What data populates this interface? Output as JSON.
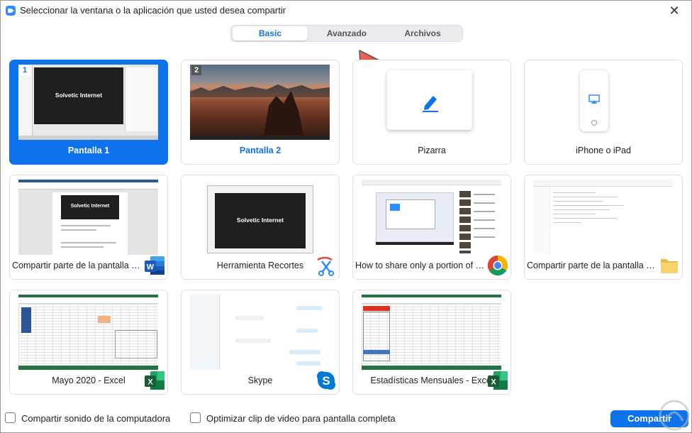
{
  "window": {
    "title": "Seleccionar la ventana o la aplicación que usted desea compartir",
    "close_icon": "✕"
  },
  "tabs": [
    {
      "label": "Basic",
      "active": true
    },
    {
      "label": "Avanzado",
      "active": false
    },
    {
      "label": "Archivos",
      "active": false
    }
  ],
  "cards": [
    {
      "label": "Pantalla 1",
      "number": "1",
      "selected": true,
      "thumb": "desktop-screen"
    },
    {
      "label": "Pantalla 2",
      "number": "2",
      "selected": false,
      "thumb": "desert-wallpaper"
    },
    {
      "label": "Pizarra",
      "thumb": "whiteboard"
    },
    {
      "label": "iPhone o iPad",
      "thumb": "ipad-airplay"
    },
    {
      "label": "Compartir parte de la pantalla en ...",
      "thumb": "word-document",
      "app_icon": "word-icon"
    },
    {
      "label": "Herramienta Recortes",
      "thumb": "snipping-window",
      "app_icon": "snipping-tool-icon"
    },
    {
      "label": "How to share only a portion of y...",
      "thumb": "youtube-page",
      "app_icon": "chrome-icon"
    },
    {
      "label": "Compartir parte de la pantalla en ...",
      "thumb": "file-explorer",
      "app_icon": "folder-icon"
    },
    {
      "label": "Mayo 2020 - Excel",
      "thumb": "excel-sheet",
      "app_icon": "excel-icon"
    },
    {
      "label": "Skype",
      "thumb": "skype-chat",
      "app_icon": "skype-icon"
    },
    {
      "label": "Estadísticas Mensuales - Excel",
      "thumb": "excel-sheet-red",
      "app_icon": "excel-icon"
    }
  ],
  "thumb_text": "Solvetic Internet",
  "footer": {
    "share_sound": "Compartir sonido de la computadora",
    "optimize_video": "Optimizar clip de video para pantalla completa",
    "share_button": "Compartir"
  },
  "colors": {
    "accent": "#0e72ed",
    "annotation_arrow": "#e8453c",
    "excel_green": "#217346",
    "word_blue": "#2b579a"
  }
}
